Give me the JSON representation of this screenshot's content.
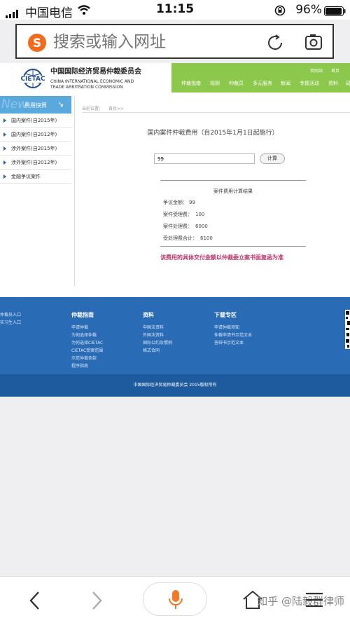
{
  "status_bar": {
    "carrier": "中国电信",
    "time": "11:15",
    "battery": "96%"
  },
  "url_bar": {
    "placeholder": "搜索或输入网址"
  },
  "site": {
    "logo_title": "中国国际经济贸易仲裁委员会",
    "logo_en_line1": "CHINA INTERNATIONAL ECONOMIC AND",
    "logo_en_line2": "TRADE ARBITRATION COMMISSION",
    "logo_mark": "CIETAC",
    "top_links": [
      "贸网站",
      "首页"
    ],
    "nav_items": [
      "仲裁指南",
      "规则",
      "仲裁员",
      "多元服务",
      "新闻",
      "专题活动",
      "资料",
      "研"
    ],
    "sidebar": {
      "header": "费用快算",
      "header_bg": "New",
      "items": [
        "国内案件(自2015年)",
        "国内案件(自2012年)",
        "涉外案件(自2015年)",
        "涉外案件(自2012年)",
        "金融争议案件"
      ]
    },
    "breadcrumb": {
      "label": "当前位置：",
      "home": "首页>>"
    },
    "page_title": "国内案件仲裁费用（自2015年1月1日起施行）",
    "amount_input": "99",
    "calc_button": "计算",
    "result": {
      "title": "案件费用计算结果",
      "rows": [
        {
          "label": "争议金额：",
          "value": "99"
        },
        {
          "label": "案件受理费：",
          "value": "100"
        },
        {
          "label": "案件处理费：",
          "value": "6000"
        },
        {
          "label": "受处理费合计：",
          "value": "6100"
        }
      ],
      "notice": "该费用的具体交付金额以仲裁委立案书面复函为准"
    },
    "footer": {
      "left_links": [
        "仲裁员入口",
        "实习生入口"
      ],
      "col1_title": "仲裁指南",
      "col1_links": [
        "申请仲裁",
        "为何选择仲裁",
        "为何选择CIETAC",
        "CIETAC受案范围",
        "示范仲裁条款",
        "程序指南"
      ],
      "col2_title": "资料",
      "col2_links": [
        "中国法资料",
        "外国法资料",
        "国际公约及惯例",
        "格式合同"
      ],
      "col3_title": "下载专区",
      "col3_links": [
        "申请仲裁须知",
        "仲裁申请书示范文本",
        "答辩书示范文本"
      ],
      "copyright": "中国国际经济贸易仲裁委员会 2015版权所有"
    }
  },
  "watermark": "知乎 @陆毅群律师",
  "colors": {
    "nav_green": "#8cc84b",
    "sidebar_blue": "#5aa9dd",
    "footer_blue": "#2a6bb5",
    "notice_red": "#c0336b"
  }
}
